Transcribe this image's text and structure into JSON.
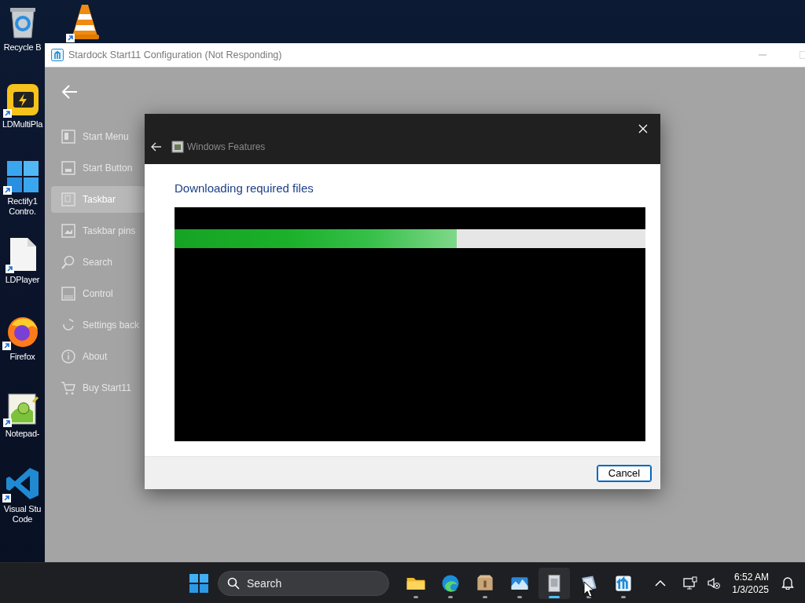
{
  "desktop_icons": [
    {
      "kind": "recycle",
      "label": "Recycle B"
    },
    {
      "kind": "vlc"
    },
    {
      "kind": "ldmulti",
      "label": "LDMultiPla"
    },
    {
      "kind": "rectify",
      "label": "Rectify1 Contro."
    },
    {
      "kind": "file",
      "label": "LDPlayer"
    },
    {
      "kind": "firefox",
      "label": "Firefox"
    },
    {
      "kind": "notepad",
      "label": "Notepad-"
    },
    {
      "kind": "vscode",
      "label": "Visual Stu Code"
    }
  ],
  "window": {
    "title": "Stardock Start11 Configuration (Not Responding)",
    "sidebar": {
      "items": [
        {
          "kind": "startmenu",
          "label": "Start Menu",
          "selected": false
        },
        {
          "kind": "startbutton",
          "label": "Start Button",
          "selected": false
        },
        {
          "kind": "taskbar",
          "label": "Taskbar",
          "selected": true
        },
        {
          "kind": "pins",
          "label": "Taskbar pins",
          "selected": false
        },
        {
          "kind": "search",
          "label": "Search",
          "selected": false
        },
        {
          "kind": "control",
          "label": "Control",
          "selected": false
        },
        {
          "kind": "backup",
          "label": "Settings back",
          "selected": false
        },
        {
          "kind": "about",
          "label": "About",
          "selected": false
        },
        {
          "kind": "buy",
          "label": "Buy Start11",
          "selected": false
        }
      ]
    }
  },
  "dialog": {
    "title": "Windows Features",
    "heading": "Downloading required files",
    "progress": {
      "level": 0.6
    },
    "buttons": [
      "Cancel"
    ]
  },
  "taskbar": {
    "search": {
      "placeholder": "Search"
    },
    "apps": [
      {
        "kind": "explorer",
        "active": false
      },
      {
        "kind": "edge",
        "active": false
      },
      {
        "kind": "package",
        "active": false
      },
      {
        "kind": "photo",
        "active": false
      },
      {
        "kind": "features",
        "active": true
      },
      {
        "kind": "notebook",
        "active": false
      },
      {
        "kind": "start11",
        "active": false
      }
    ],
    "time": "6:52 AM",
    "date": "1/3/2025"
  }
}
